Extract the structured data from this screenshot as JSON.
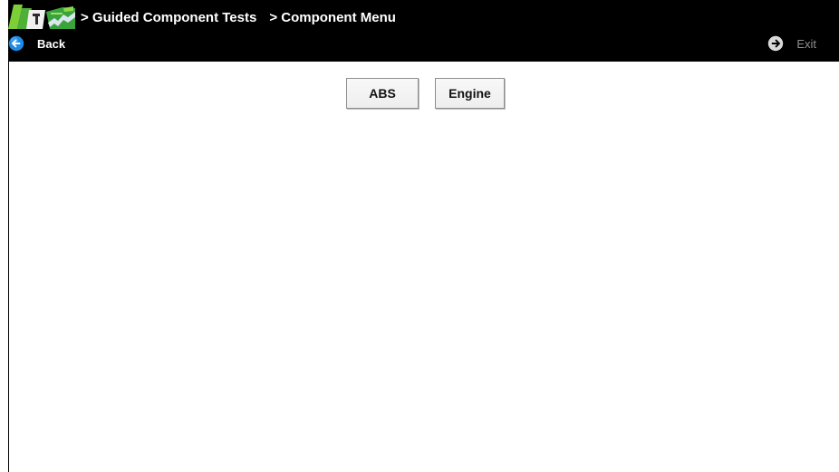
{
  "header": {
    "breadcrumbs": [
      "> Guided Component Tests",
      "> Component Menu"
    ],
    "back_label": "Back",
    "exit_label": "Exit",
    "icons": {
      "logo": "app-logo-icon",
      "back": "back-arrow-icon",
      "exit": "exit-arrow-icon"
    },
    "colors": {
      "bar": "#000000",
      "back_icon": "#1c8be6",
      "exit_icon": "#d9d9d9",
      "exit_text": "#8f8f8f"
    }
  },
  "menu": {
    "items": [
      "ABS",
      "Engine"
    ]
  }
}
